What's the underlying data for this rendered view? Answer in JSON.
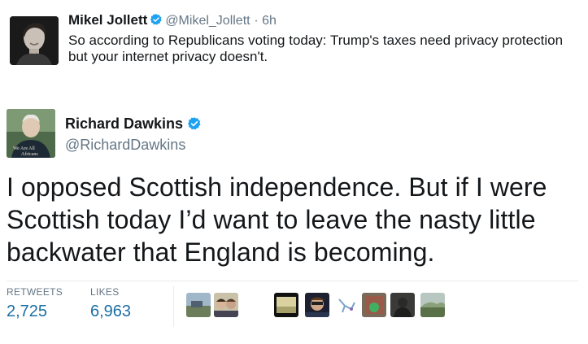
{
  "quoted_tweet": {
    "name": "Mikel Jollett",
    "handle": "@Mikel_Jollett",
    "time": "· 6h",
    "text": "So according to Republicans voting today: Trump's taxes need privacy protection but your internet privacy doesn't."
  },
  "tweet": {
    "author_name": "Richard Dawkins",
    "author_handle": "@RichardDawkins",
    "avatar_caption": "We Are All Africans",
    "text": "I opposed Scottish independence. But if I were Scottish today I’d want to leave the nasty little backwater that England is becoming."
  },
  "stats": {
    "retweets_label": "RETWEETS",
    "retweets_value": "2,725",
    "likes_label": "LIKES",
    "likes_value": "6,963"
  },
  "colors": {
    "verified": "#1da1f2",
    "link_blue": "#1b6ea5",
    "muted": "#657786"
  },
  "likers": [
    "liker-avatar-1",
    "liker-avatar-2",
    "liker-avatar-3",
    "liker-avatar-4",
    "liker-avatar-5",
    "liker-avatar-6",
    "liker-avatar-7",
    "liker-avatar-8"
  ]
}
